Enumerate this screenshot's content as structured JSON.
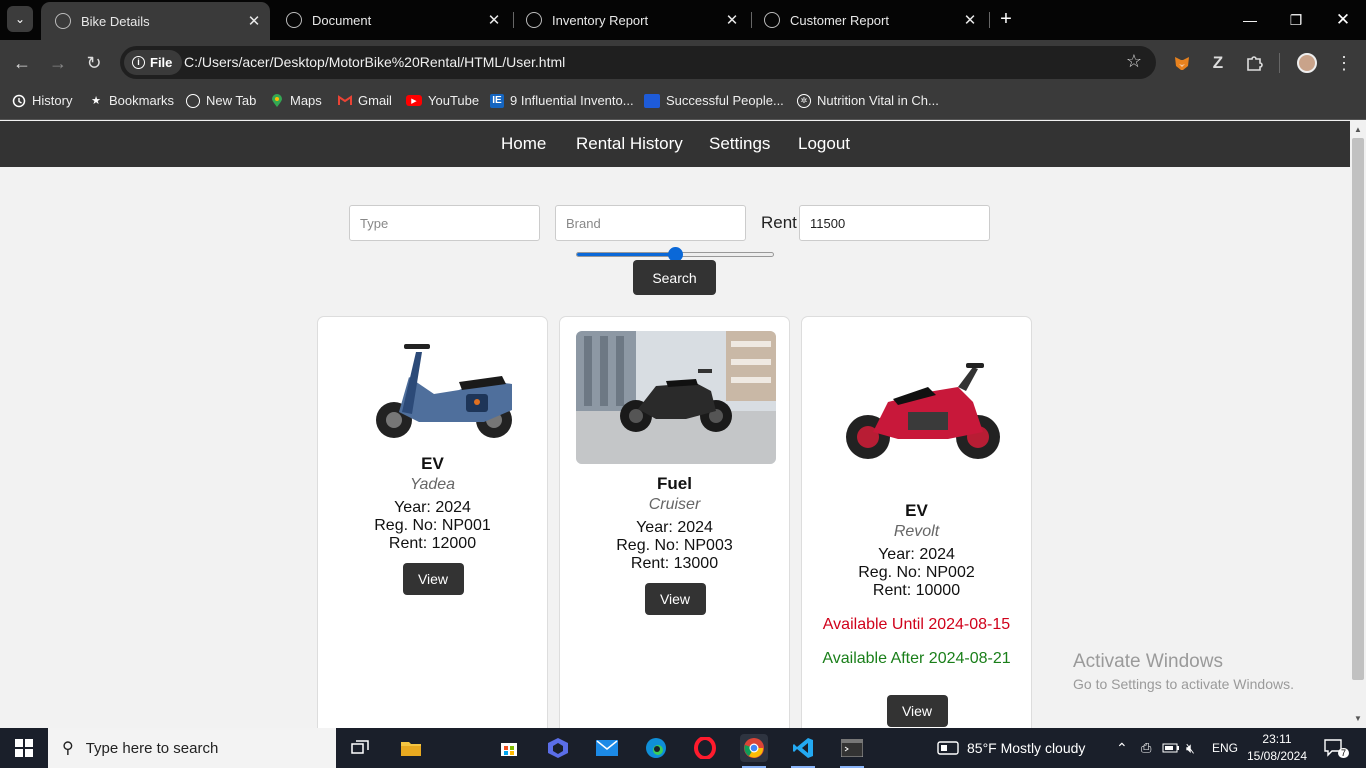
{
  "browser": {
    "tabs": [
      {
        "title": "Bike Details",
        "active": true
      },
      {
        "title": "Document",
        "active": false
      },
      {
        "title": "Inventory Report",
        "active": false
      },
      {
        "title": "Customer Report",
        "active": false
      }
    ],
    "address": {
      "scheme_label": "File",
      "url": "C:/Users/acer/Desktop/MotorBike%20Rental/HTML/User.html"
    },
    "bookmarks": [
      "History",
      "Bookmarks",
      "New Tab",
      "Maps",
      "Gmail",
      "YouTube",
      "9 Influential Invento...",
      "Successful People...",
      "Nutrition Vital in Ch..."
    ]
  },
  "nav": {
    "home": "Home",
    "rental_history": "Rental History",
    "settings": "Settings",
    "logout": "Logout"
  },
  "filters": {
    "type_placeholder": "Type",
    "brand_placeholder": "Brand",
    "rent_label": "Rent",
    "rent_value": "11500",
    "slider_fraction": 0.5,
    "search_label": "Search"
  },
  "bikes": [
    {
      "type": "EV",
      "brand": "Yadea",
      "year": "Year: 2024",
      "reg": "Reg. No: NP001",
      "rent": "Rent: 12000",
      "view": "View",
      "image": "blue-electric-scooter"
    },
    {
      "type": "Fuel",
      "brand": "Cruiser",
      "year": "Year: 2024",
      "reg": "Reg. No: NP003",
      "rent": "Rent: 13000",
      "view": "View",
      "image": "black-cruiser-motorcycle"
    },
    {
      "type": "EV",
      "brand": "Revolt",
      "year": "Year: 2024",
      "reg": "Reg. No: NP002",
      "rent": "Rent: 10000",
      "view": "View",
      "image": "red-electric-motorcycle",
      "available_until": "Available Until 2024-08-15",
      "available_after": "Available After 2024-08-21"
    }
  ],
  "colors": {
    "navbar": "#333333",
    "accent": "#0a68d8",
    "until": "#d0021b",
    "after": "#1a7f1a"
  },
  "watermark": {
    "line1": "Activate Windows",
    "line2": "Go to Settings to activate Windows."
  },
  "taskbar": {
    "search_placeholder": "Type here to search",
    "weather": "85°F  Mostly cloudy",
    "lang": "ENG",
    "time": "23:11",
    "date": "15/08/2024",
    "notifications": "7"
  }
}
